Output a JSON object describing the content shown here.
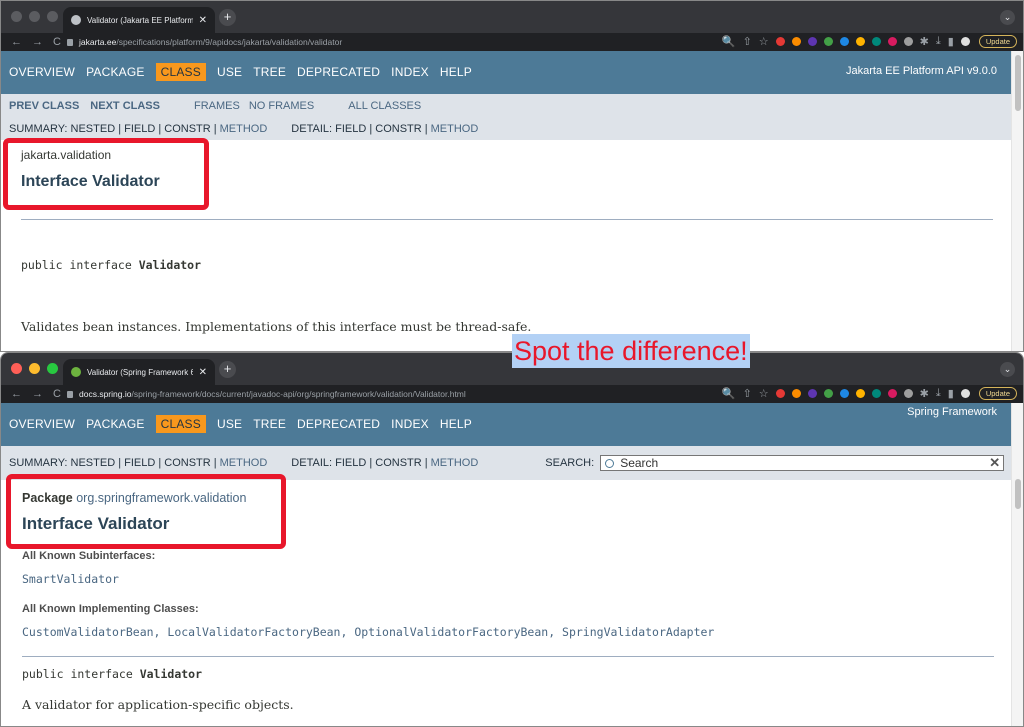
{
  "windows": [
    {
      "tab_title": "Validator (Jakarta EE Platform",
      "url_domain": "jakarta.ee",
      "url_path": "/specifications/platform/9/apidocs/jakarta/validation/validator",
      "update_label": "Update",
      "nav": [
        "OVERVIEW",
        "PACKAGE",
        "CLASS",
        "USE",
        "TREE",
        "DEPRECATED",
        "INDEX",
        "HELP"
      ],
      "active_nav": "CLASS",
      "about": "Jakarta EE Platform API v9.0.0",
      "subnav": {
        "prev_class": "PREV CLASS",
        "next_class": "NEXT CLASS",
        "frames": "FRAMES",
        "no_frames": "NO FRAMES",
        "all_classes": "ALL CLASSES",
        "summary_prefix": "SUMMARY: NESTED | FIELD | CONSTR | ",
        "summary_method": "METHOD",
        "detail_prefix": "DETAIL: FIELD | CONSTR | ",
        "detail_method": "METHOD"
      },
      "package": "jakarta.validation",
      "title": "Interface Validator",
      "signature_prefix": "public interface ",
      "signature_name": "Validator",
      "description": "Validates bean instances. Implementations of this interface must be thread-safe."
    },
    {
      "tab_title": "Validator (Spring Framework 6",
      "url_domain": "docs.spring.io",
      "url_path": "/spring-framework/docs/current/javadoc-api/org/springframework/validation/Validator.html",
      "update_label": "Update",
      "nav": [
        "OVERVIEW",
        "PACKAGE",
        "CLASS",
        "USE",
        "TREE",
        "DEPRECATED",
        "INDEX",
        "HELP"
      ],
      "active_nav": "CLASS",
      "about": "Spring Framework",
      "subnav": {
        "summary_prefix": "SUMMARY: NESTED | FIELD | CONSTR | ",
        "summary_method": "METHOD",
        "detail_prefix": "DETAIL: FIELD | CONSTR | ",
        "detail_method": "METHOD",
        "search_label": "SEARCH:",
        "search_placeholder": "Search"
      },
      "package_label": "Package",
      "package": "org.springframework.validation",
      "title": "Interface Validator",
      "subinterfaces_label": "All Known Subinterfaces:",
      "subinterfaces": "SmartValidator",
      "implementing_label": "All Known Implementing Classes:",
      "implementing": "CustomValidatorBean, LocalValidatorFactoryBean, OptionalValidatorFactoryBean, SpringValidatorAdapter",
      "signature_prefix": "public interface ",
      "signature_name": "Validator",
      "description": "A validator for application-specific objects."
    }
  ],
  "caption": "Spot the difference!",
  "colors": {
    "nav_bg": "#4d7a97",
    "active_tab": "#f8981d",
    "subnav_bg": "#dee3e9",
    "highlight_box": "#e8172b",
    "caption_bg": "#b3d1f5"
  }
}
